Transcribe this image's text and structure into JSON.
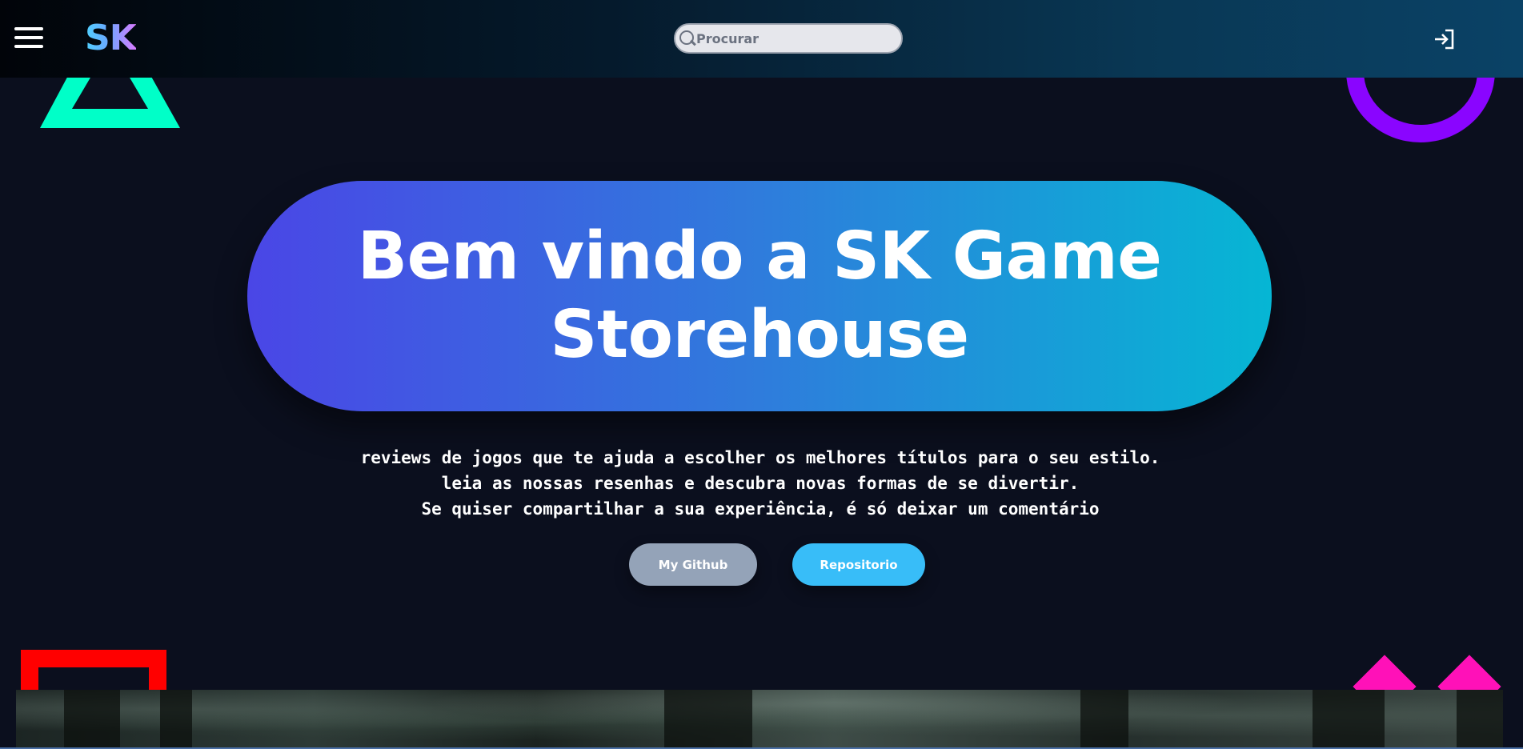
{
  "header": {
    "logo_text": "SK",
    "search": {
      "placeholder": "Procurar"
    },
    "login_icon": "login-icon",
    "menu_icon": "hamburger-menu-icon"
  },
  "hero": {
    "title": "Bem vindo a SK Game Storehouse",
    "description": [
      "reviews de jogos que te ajuda a escolher os melhores títulos para o seu estilo.",
      "leia as nossas resenhas e descubra novas formas de se divertir.",
      "Se quiser compartilhar a sua experiência, é só deixar um comentário"
    ],
    "buttons": {
      "github_label": "My Github",
      "repo_label": "Repositorio"
    }
  },
  "colors": {
    "background": "#0b0f1e",
    "triangle": "#00ffc8",
    "circle": "#8a05ff",
    "square": "#ff0000",
    "diamond": "#ff11b8",
    "github_button": "#94a3b8",
    "repo_button": "#38bdf8",
    "hero_gradient_start": "#4a46e6",
    "hero_gradient_end": "#06b6d4"
  }
}
